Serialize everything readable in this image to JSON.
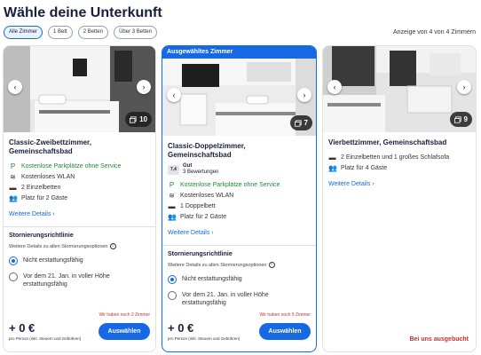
{
  "header": {
    "title": "Wähle deine Unterkunft",
    "count": "Anzeige von 4 von 4 Zimmern"
  },
  "filters": [
    {
      "label": "Alle Zimmer",
      "active": true
    },
    {
      "label": "1 Bett",
      "active": false
    },
    {
      "label": "2 Betten",
      "active": false
    },
    {
      "label": "Über 3 Betten",
      "active": false
    }
  ],
  "colors": {
    "accent": "#1668e3",
    "green": "#1f8a36",
    "alert": "#c9302c"
  },
  "cards": [
    {
      "name": "Classic-Zweibettzimmer, Gemeinschaftsbad",
      "photos": "10",
      "features": [
        {
          "icon": "parking-icon",
          "text": "Kostenlose Parkplätze ohne Service",
          "green": true
        },
        {
          "icon": "wifi-icon",
          "text": "Kostenloses WLAN"
        },
        {
          "icon": "bed-icon",
          "text": "2 Einzelbetten"
        },
        {
          "icon": "guests-icon",
          "text": "Platz für 2 Gäste"
        }
      ],
      "details_link": "Weitere Details",
      "policy": {
        "title": "Stornierungsrichtlinie",
        "note": "Weitere Details zu allen Stornierungsoptionen",
        "options": [
          "Nicht erstattungsfähig",
          "Vor dem 21. Jan. in voller Höhe erstattungsfähig"
        ],
        "selected": 0
      },
      "left_note": "Wir haben noch 2 Zimmer",
      "price": "+ 0 €",
      "price_note": "pro Person (inkl. Steuern und Gebühren)",
      "button": "Auswählen"
    },
    {
      "banner": "Ausgewähltes Zimmer",
      "name": "Classic-Doppelzimmer, Gemeinschaftsbad",
      "photos": "7",
      "rating": {
        "score": "7,4",
        "label": "Gut",
        "reviews": "3 Bewertungen"
      },
      "features": [
        {
          "icon": "parking-icon",
          "text": "Kostenlose Parkplätze ohne Service",
          "green": true
        },
        {
          "icon": "wifi-icon",
          "text": "Kostenloses WLAN"
        },
        {
          "icon": "bed-icon",
          "text": "1 Doppelbett"
        },
        {
          "icon": "guests-icon",
          "text": "Platz für 2 Gäste"
        }
      ],
      "details_link": "Weitere Details",
      "policy": {
        "title": "Stornierungsrichtlinie",
        "note": "Weitere Details zu allen Stornierungsoptionen",
        "options": [
          "Nicht erstattungsfähig",
          "Vor dem 21. Jan. in voller Höhe erstattungsfähig"
        ],
        "selected": 0
      },
      "left_note": "Wir haben noch 5 Zimmer",
      "price": "+ 0 €",
      "price_note": "pro Person (inkl. Steuern und Gebühren)",
      "button": "Auswählen"
    },
    {
      "name": "Vierbettzimmer, Gemeinschaftsbad",
      "photos": "9",
      "features": [
        {
          "icon": "bed-icon",
          "text": "2 Einzelbetten und 1 großes Schlafsofa"
        },
        {
          "icon": "guests-icon",
          "text": "Platz für 4 Gäste"
        }
      ],
      "details_link": "Weitere Details",
      "sold_out": "Bei uns ausgebucht"
    }
  ]
}
